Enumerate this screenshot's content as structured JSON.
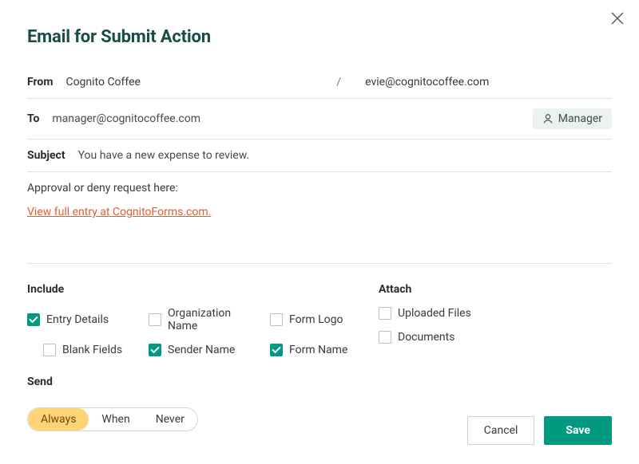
{
  "dialog": {
    "title": "Email for Submit Action"
  },
  "from": {
    "label": "From",
    "name": "Cognito Coffee",
    "separator": "/",
    "email": "evie@cognitocoffee.com"
  },
  "to": {
    "label": "To",
    "value": "manager@cognitocoffee.com",
    "role_chip": "Manager"
  },
  "subject": {
    "label": "Subject",
    "value": "You have a new expense to review."
  },
  "body": {
    "text": "Approval or deny request here:",
    "link": "View full entry at CognitoForms.com."
  },
  "include": {
    "title": "Include",
    "items": [
      {
        "label": "Entry Details",
        "checked": true
      },
      {
        "label": "Organization Name",
        "checked": false
      },
      {
        "label": "Form Logo",
        "checked": false
      },
      {
        "label": "Blank Fields",
        "checked": false,
        "indent": true
      },
      {
        "label": "Sender Name",
        "checked": true
      },
      {
        "label": "Form Name",
        "checked": true
      }
    ]
  },
  "attach": {
    "title": "Attach",
    "items": [
      {
        "label": "Uploaded Files",
        "checked": false
      },
      {
        "label": "Documents",
        "checked": false
      }
    ]
  },
  "send": {
    "title": "Send",
    "options": [
      "Always",
      "When",
      "Never"
    ],
    "selected": "Always"
  },
  "footer": {
    "cancel": "Cancel",
    "save": "Save"
  }
}
